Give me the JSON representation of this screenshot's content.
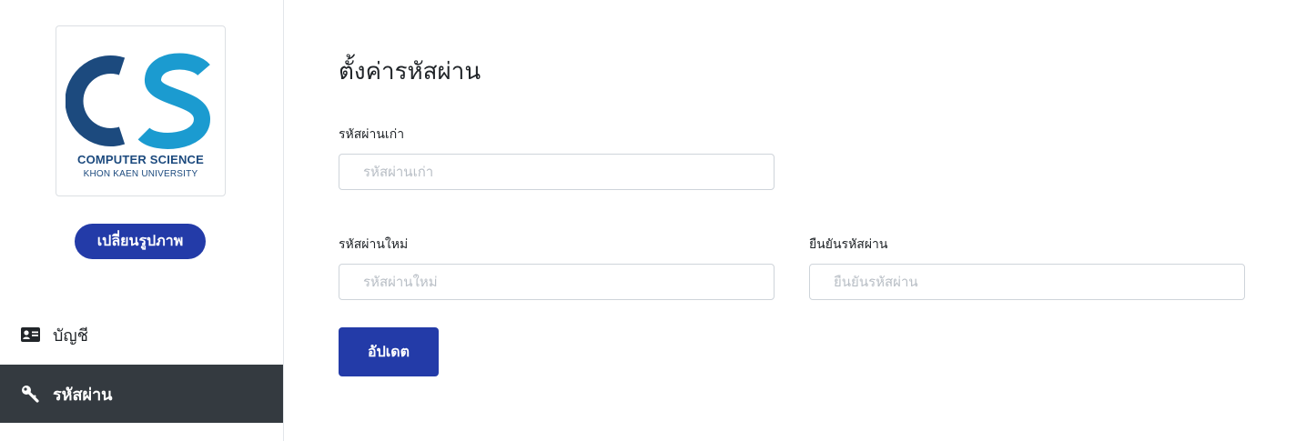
{
  "sidebar": {
    "logo": {
      "line1": "COMPUTER SCIENCE",
      "line2": "KHON KAEN UNIVERSITY",
      "colors": {
        "dark": "#1c4a7e",
        "light": "#1b9bd0"
      }
    },
    "change_photo_label": "เปลี่ยนรูปภาพ",
    "items": [
      {
        "label": "บัญชี",
        "icon": "id-card-icon",
        "active": false
      },
      {
        "label": "รหัสผ่าน",
        "icon": "key-icon",
        "active": true
      }
    ]
  },
  "main": {
    "title": "ตั้งค่ารหัสผ่าน",
    "old_password": {
      "label": "รหัสผ่านเก่า",
      "placeholder": "รหัสผ่านเก่า",
      "value": ""
    },
    "new_password": {
      "label": "รหัสผ่านใหม่",
      "placeholder": "รหัสผ่านใหม่",
      "value": ""
    },
    "confirm_password": {
      "label": "ยืนยันรหัสผ่าน",
      "placeholder": "ยืนยันรหัสผ่าน",
      "value": ""
    },
    "update_label": "อัปเดต"
  },
  "colors": {
    "primary": "#233ba8",
    "active_nav_bg": "#343a40"
  }
}
